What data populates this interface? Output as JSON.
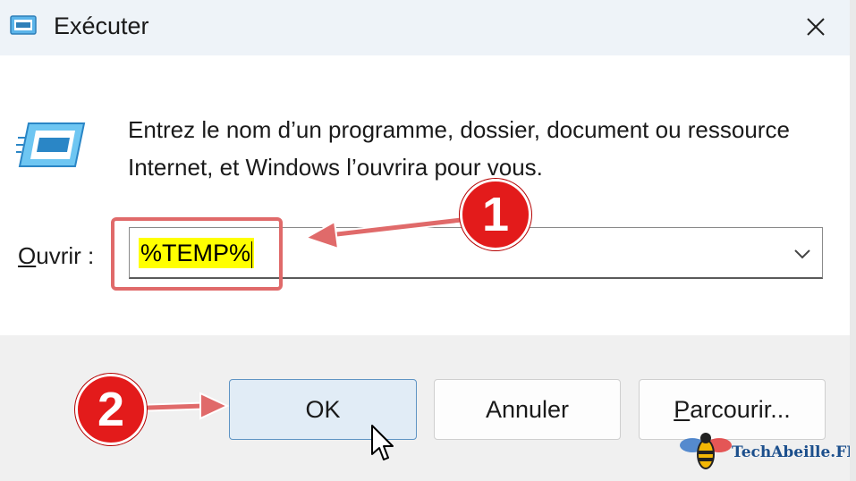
{
  "window": {
    "title": "Exécuter",
    "title_icon": "run-icon",
    "close_icon": "close-icon"
  },
  "body": {
    "description": "Entrez le nom d’un programme, dossier, document ou ressource Internet, et Windows l’ouvrira pour vous.",
    "open_label_accel": "O",
    "open_label_rest": "uvrir :",
    "open_value": "%TEMP%",
    "dropdown_icon": "chevron-down-icon"
  },
  "buttons": {
    "ok": "OK",
    "cancel": "Annuler",
    "browse_accel": "P",
    "browse_rest": "arcourir..."
  },
  "annotations": {
    "step1": "1",
    "step2": "2",
    "highlight_color": "#e06a6a",
    "badge_color": "#e31b1b"
  },
  "watermark": {
    "text": "TechAbeille.FR"
  },
  "colors": {
    "title_bg": "#eef3f8",
    "footer_bg": "#f0f0f0",
    "ok_bg": "#e1ecf6",
    "ok_border": "#5f94c4",
    "input_highlight": "#ffff00"
  }
}
